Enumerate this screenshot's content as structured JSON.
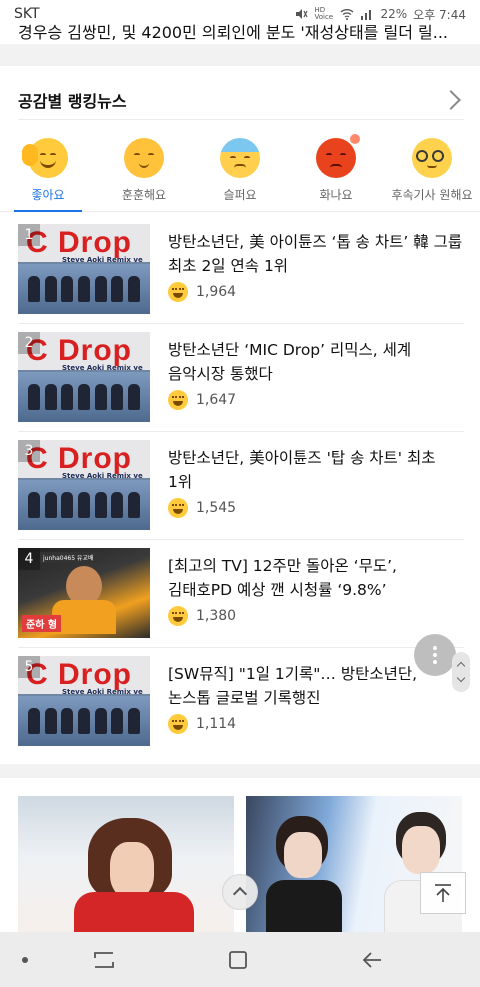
{
  "status_bar": {
    "carrier": "SKT",
    "volte_label": "HD Voice",
    "battery": "22%",
    "time": "오후 7:44"
  },
  "cut_headline": "경우승 김쌍민, 및 4200민 의뢰인에 분도 '재성상태를 릴더 릴...",
  "section": {
    "title": "공감별 랭킹뉴스"
  },
  "emotion_tabs": [
    {
      "label": "좋아요",
      "icon": "like-face-icon",
      "active": true
    },
    {
      "label": "훈훈해요",
      "icon": "warm-face-icon",
      "active": false
    },
    {
      "label": "슬퍼요",
      "icon": "sad-face-icon",
      "active": false
    },
    {
      "label": "화나요",
      "icon": "angry-face-icon",
      "active": false
    },
    {
      "label": "후속기사 원해요",
      "icon": "follow-up-face-icon",
      "active": false
    }
  ],
  "news": [
    {
      "rank": "1",
      "title": "방탄소년단, 美 아이튠즈 ‘톱 송 차트’ 韓 그룹 최초 2일 연속 1위",
      "count": "1,964",
      "thumb": "mic-drop"
    },
    {
      "rank": "2",
      "title": "방탄소년단 ‘MIC Drop’ 리믹스, 세계 음악시장 통했다",
      "count": "1,647",
      "thumb": "mic-drop"
    },
    {
      "rank": "3",
      "title": "방탄소년단, 美아이튠즈 '탑 송 차트' 최초 1위",
      "count": "1,545",
      "thumb": "mic-drop"
    },
    {
      "rank": "4",
      "title": "[최고의 TV] 12주만 돌아온 ‘무도’, 김태호PD 예상 깬 시청률 ‘9.8%’",
      "count": "1,380",
      "thumb": "tv"
    },
    {
      "rank": "5",
      "title": "[SW뮤직] \"1일 1기록\"… 방탄소년단, 논스톱 글로벌 기록행진",
      "count": "1,114",
      "thumb": "mic-drop"
    }
  ],
  "thumb_text": {
    "logo": "C Drop",
    "sub": "Steve Aoki Remix ve",
    "tv_caption": "준하 형",
    "tv_top_caption": "junha0465 유교배"
  },
  "colors": {
    "accent": "#1a73e8",
    "reaction_yellow": "#ffcb3d",
    "angry_red": "#e8431c"
  }
}
